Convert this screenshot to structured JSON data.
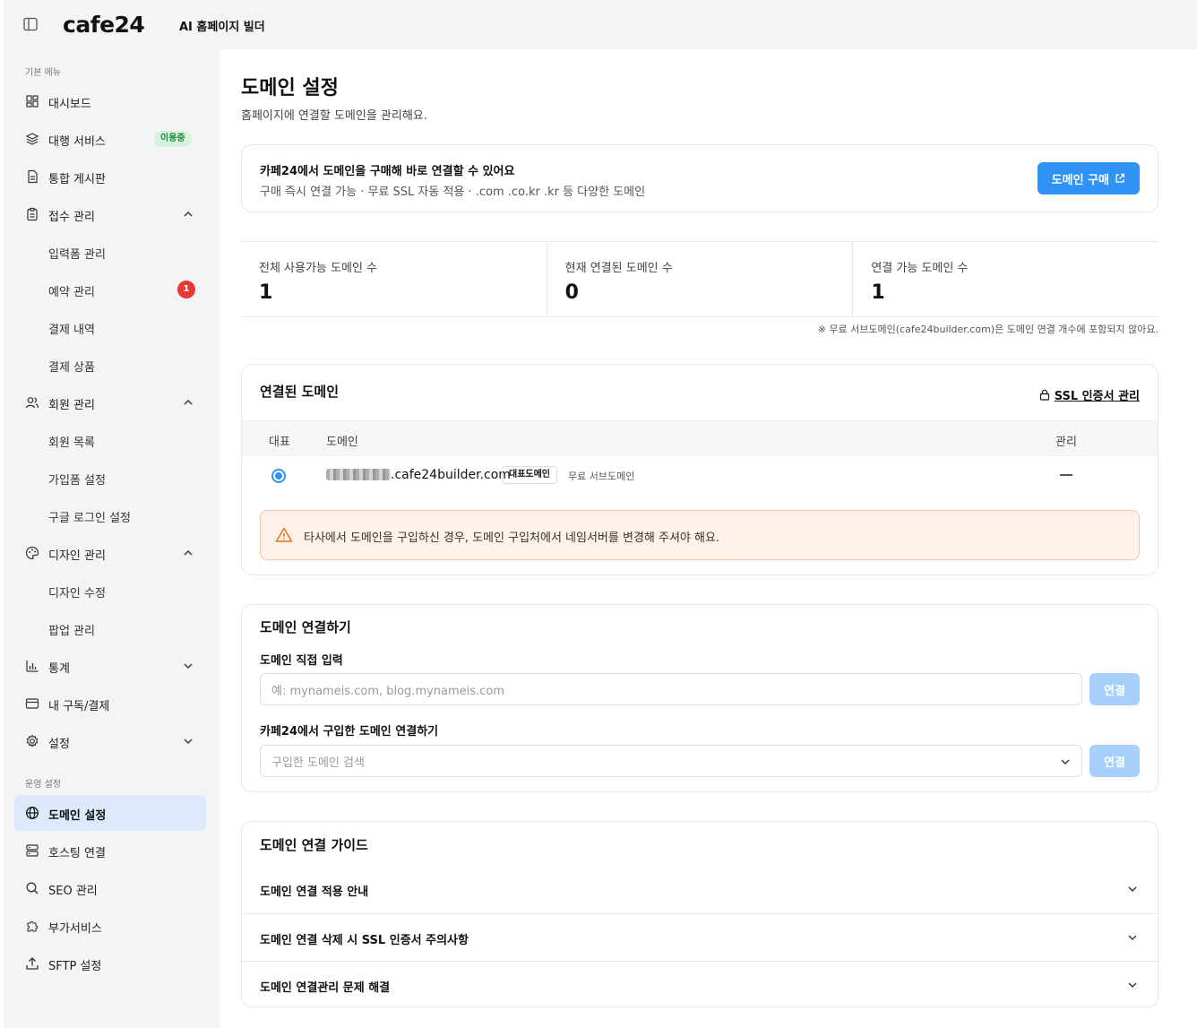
{
  "header": {
    "logo": "cafe24",
    "subtitle": "AI 홈페이지 빌더"
  },
  "sidebar": {
    "section_basic": "기본 메뉴",
    "section_ops": "운영 설정",
    "items": [
      {
        "label": "대시보드",
        "icon": "grid-icon"
      },
      {
        "label": "대행 서비스",
        "icon": "layers-icon",
        "badge": "이용중"
      },
      {
        "label": "통합 게시판",
        "icon": "document-icon"
      },
      {
        "label": "접수 관리",
        "icon": "clipboard-icon",
        "expanded": true
      },
      {
        "label": "입력폼 관리"
      },
      {
        "label": "예약 관리",
        "badge": "1"
      },
      {
        "label": "결제 내역"
      },
      {
        "label": "결제 상품"
      },
      {
        "label": "회원 관리",
        "icon": "users-icon",
        "expanded": true
      },
      {
        "label": "회원 목록"
      },
      {
        "label": "가입폼 설정"
      },
      {
        "label": "구글 로그인 설정"
      },
      {
        "label": "디자인 관리",
        "icon": "palette-icon",
        "expanded": true
      },
      {
        "label": "디자인 수정"
      },
      {
        "label": "팝업 관리"
      },
      {
        "label": "통계",
        "icon": "bar-chart-icon",
        "expanded": false
      },
      {
        "label": "내 구독/결제",
        "icon": "card-icon"
      },
      {
        "label": "설정",
        "icon": "gear-icon",
        "expanded": false
      }
    ],
    "ops_items": [
      {
        "label": "도메인 설정",
        "icon": "globe-icon",
        "active": true
      },
      {
        "label": "호스팅 연결",
        "icon": "server-icon"
      },
      {
        "label": "SEO 관리",
        "icon": "search-icon"
      },
      {
        "label": "부가서비스",
        "icon": "puzzle-icon"
      },
      {
        "label": "SFTP 설정",
        "icon": "upload-icon"
      }
    ]
  },
  "page": {
    "title": "도메인 설정",
    "description": "홈페이지에 연결할 도메인을 관리해요."
  },
  "promo": {
    "title": "카페24에서 도메인을 구매해 바로 연결할 수 있어요",
    "description": "구매 즉시 연결 가능 · 무료 SSL 자동 적용 · .com .co.kr .kr 등 다양한 도메인",
    "button": "도메인 구매"
  },
  "stats": {
    "items": [
      {
        "label": "전체 사용가능 도메인 수",
        "value": "1"
      },
      {
        "label": "현재 연결된 도메인 수",
        "value": "0"
      },
      {
        "label": "연결 가능 도메인 수",
        "value": "1"
      }
    ],
    "note": "※ 무료 서브도메인(cafe24builder.com)은 도메인 연결 개수에 포함되지 않아요."
  },
  "connected": {
    "title": "연결된 도메인",
    "ssl_link": "SSL 인증서 관리",
    "col_rep": "대표",
    "col_domain": "도메인",
    "col_manage": "관리",
    "row": {
      "domain": ".cafe24builder.com",
      "tag_rep": "대표도메인",
      "tag_free": "무료 서브도메인"
    },
    "warning": "타사에서 도메인을 구입하신 경우, 도메인 구입처에서 네임서버를 변경해 주셔야 해요."
  },
  "connect": {
    "title": "도메인 연결하기",
    "direct_label": "도메인 직접 입력",
    "direct_placeholder": "예: mynameis.com, blog.mynameis.com",
    "connect_button": "연결",
    "cafe24_label": "카페24에서 구입한 도메인 연결하기",
    "cafe24_placeholder": "구입한 도메인 검색"
  },
  "guide": {
    "title": "도메인 연결 가이드",
    "items": [
      "도메인 연결 적용 안내",
      "도메인 연결 삭제 시 SSL 인증서 주의사항",
      "도메인 연결관리 문제 해결"
    ]
  },
  "colors": {
    "primary": "#2f93f5",
    "active_bg": "#dbe9fb",
    "warning_bg": "#fdf1ea",
    "badge_green": "#1f8a3a",
    "badge_red": "#e53935"
  }
}
